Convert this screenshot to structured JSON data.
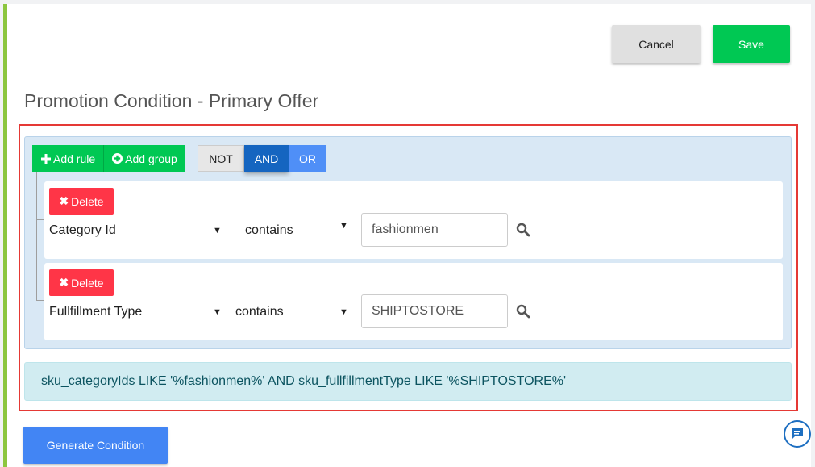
{
  "header": {
    "cancel_label": "Cancel",
    "save_label": "Save"
  },
  "page_title": "Promotion Condition - Primary Offer",
  "builder": {
    "add_rule_label": "Add rule",
    "add_group_label": "Add group",
    "conjunctions": [
      "NOT",
      "AND",
      "OR"
    ],
    "active_conjunction": "AND",
    "rules": [
      {
        "delete_label": "Delete",
        "field": "Category Id",
        "operator": "contains",
        "value": "fashionmen"
      },
      {
        "delete_label": "Delete",
        "field": "Fullfillment Type",
        "operator": "contains",
        "value": "SHIPTOSTORE"
      }
    ]
  },
  "sql_output": "sku_categoryIds LIKE '%fashionmen%' AND sku_fullfillmentType LIKE '%SHIPTOSTORE%'",
  "footer": {
    "generate_label": "Generate Condition"
  },
  "colors": {
    "accent_bar": "#8cc63f",
    "save": "#00c853",
    "delete": "#ff3547",
    "and_active": "#1565c0",
    "or": "#4f8ff7",
    "generate": "#4285f4",
    "highlight_border": "#e53935"
  },
  "icons": {
    "add_rule": "plus-icon",
    "add_group": "plus-circle-icon",
    "delete": "close-icon",
    "search": "search-icon",
    "chat": "chat-icon"
  }
}
